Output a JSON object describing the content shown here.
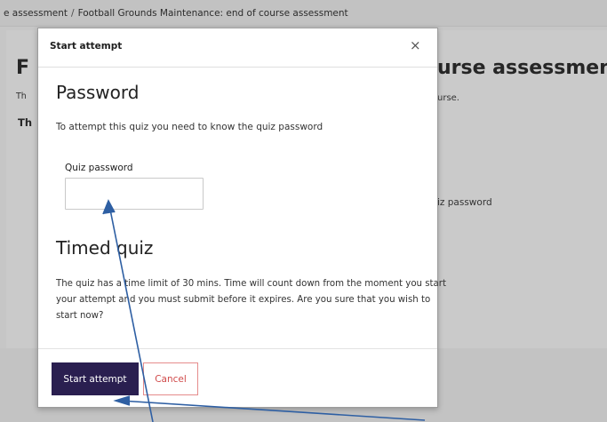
{
  "breadcrumb": {
    "items": [
      "e assessment",
      "Football Grounds Maintenance: end of course assessment"
    ],
    "separator": "/"
  },
  "background": {
    "title_left": "F",
    "title_right": "urse assessment",
    "subtitle_left": "Th",
    "subtitle_right": "urse.",
    "bold_left": "Th",
    "password_right": "iz password"
  },
  "modal": {
    "title": "Start attempt",
    "close_symbol": "×",
    "password_heading": "Password",
    "password_text": "To attempt this quiz you need to know the quiz password",
    "quiz_password_label": "Quiz password",
    "quiz_password_value": "",
    "timed_heading": "Timed quiz",
    "timed_text": "The quiz has a time limit of 30 mins. Time will count down from the moment you start your attempt and you must submit before it expires. Are you sure that you wish to start now?",
    "start_button": "Start attempt",
    "cancel_button": "Cancel"
  },
  "colors": {
    "primary_button": "#2a1f50",
    "cancel_text": "#d04a4a",
    "arrow": "#2e5fa3",
    "overlay": "#c6c6c6"
  }
}
